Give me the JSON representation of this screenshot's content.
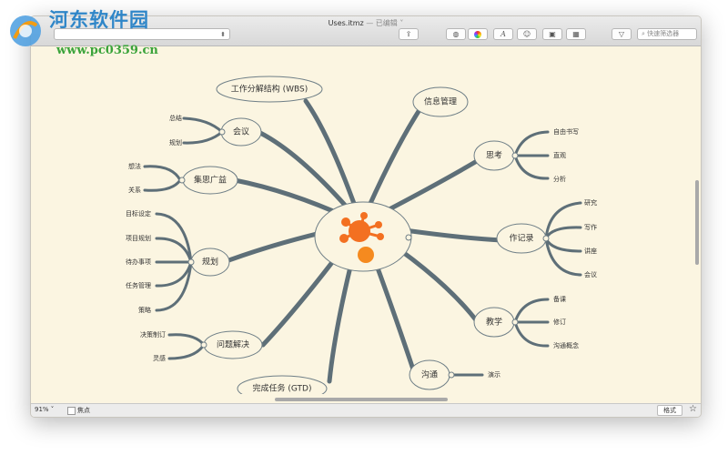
{
  "window": {
    "file_name": "Uses.itmz",
    "edited_status": "— 已编辑 ˅"
  },
  "toolbar": {
    "search_placeholder": "快速筛选器"
  },
  "mindmap": {
    "top_nodes": [
      "工作分解结构 (WBS)",
      "信息管理",
      "会议",
      "集思广益",
      "规划",
      "问题解决",
      "完成任务 (GTD)",
      "思考",
      "作记录",
      "教学",
      "沟通"
    ],
    "meeting_children": [
      "总结",
      "规划"
    ],
    "brainstorm_children": [
      "想法",
      "关系"
    ],
    "planning_children": [
      "目标设定",
      "项目规划",
      "待办事项",
      "任务管理",
      "策略"
    ],
    "problem_children": [
      "决策制订",
      "灵感"
    ],
    "thinking_children": [
      "自由书写",
      "直观",
      "分析"
    ],
    "notes_children": [
      "研究",
      "写作",
      "讲座",
      "会议"
    ],
    "teaching_children": [
      "备课",
      "修订",
      "沟通概念"
    ],
    "communication_children": [
      "演示"
    ],
    "colors": {
      "branch": "#5e6f78",
      "central": "#f37021"
    }
  },
  "statusbar": {
    "zoom": "91% ˅",
    "focus_label": "焦点",
    "style_button": "格式",
    "favorite_icon": "star-icon"
  },
  "watermark": {
    "site_name": "河东软件园",
    "url": "www.pc0359.cn"
  }
}
